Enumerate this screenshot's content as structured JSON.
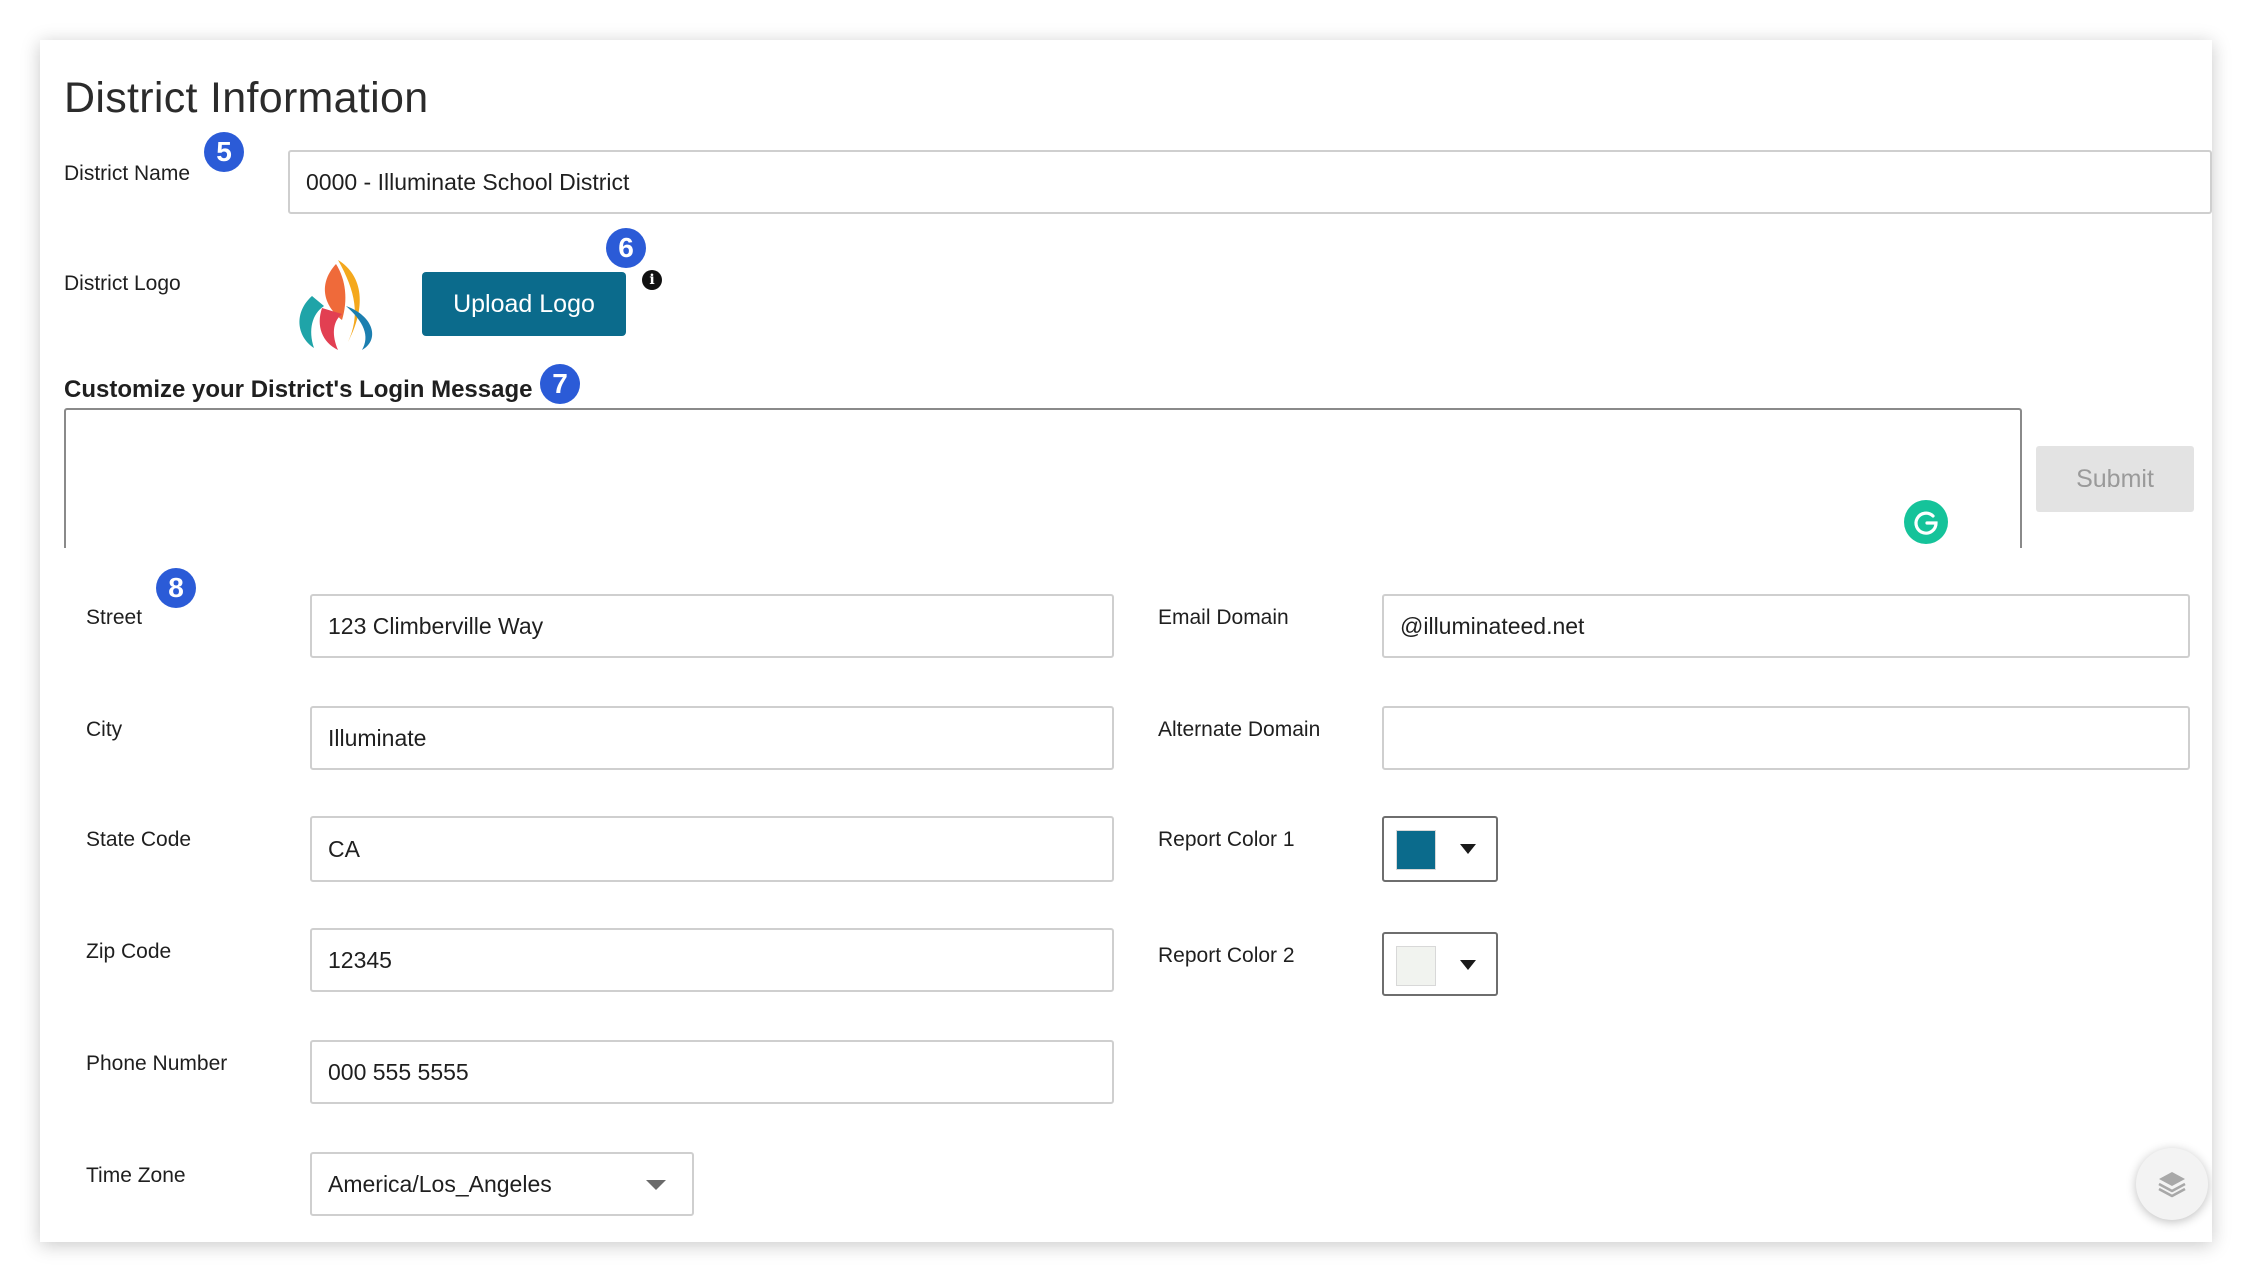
{
  "page": {
    "title": "District Information"
  },
  "district": {
    "name_label": "District Name",
    "name_value": "0000 - Illuminate School District",
    "logo_label": "District Logo",
    "upload_button": "Upload Logo",
    "info_glyph": "i"
  },
  "login_message": {
    "label": "Customize your District's Login Message",
    "value": "",
    "submit_button": "Submit"
  },
  "badges": [
    "5",
    "6",
    "7",
    "8"
  ],
  "address": {
    "street_label": "Street",
    "street_value": "123 Climberville Way",
    "city_label": "City",
    "city_value": "Illuminate",
    "state_label": "State Code",
    "state_value": "CA",
    "zip_label": "Zip Code",
    "zip_value": "12345",
    "phone_label": "Phone Number",
    "phone_value": "000 555 5555",
    "timezone_label": "Time Zone",
    "timezone_value": "America/Los_Angeles"
  },
  "domains": {
    "email_label": "Email Domain",
    "email_value": "@illuminateed.net",
    "alternate_label": "Alternate Domain",
    "alternate_value": ""
  },
  "report_colors": {
    "color1_label": "Report Color 1",
    "color1_value": "#0b6b8c",
    "color2_label": "Report Color 2",
    "color2_value": "#f1f3ef"
  },
  "icons": {
    "info": "info-icon",
    "grammarly": "grammarly-icon",
    "layers": "layers-icon",
    "logo": "flame-logo"
  }
}
